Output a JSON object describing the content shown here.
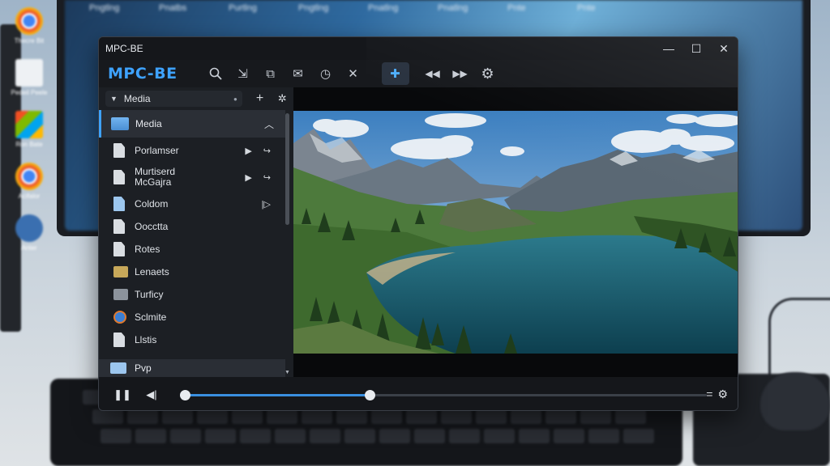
{
  "background": {
    "taskbar_labels": [
      "Pngtlng",
      "Pnatbs",
      "Purtlng",
      "Pngtlng",
      "Pnatlng",
      "Pnatlng",
      "Pnte",
      "Pnte"
    ],
    "desktop_icons": [
      {
        "label": "Thecre Bit",
        "icon": "chrome-icon"
      },
      {
        "label": "Pedeil Peele",
        "icon": "file-icon"
      },
      {
        "label": "Ron Bate",
        "icon": "app-grid-icon"
      },
      {
        "label": "Acifalor",
        "icon": "chrome-icon"
      },
      {
        "label": "Anter",
        "icon": "app-icon"
      }
    ]
  },
  "window": {
    "title": "MPC-BE",
    "controls": {
      "minimize": "—",
      "maximize": "☐",
      "close": "✕"
    }
  },
  "toolbar": {
    "brand": "MPC-BE",
    "buttons": [
      {
        "name": "search",
        "glyph": "⌕"
      },
      {
        "name": "user-add",
        "glyph": "⇲"
      },
      {
        "name": "file-stack",
        "glyph": "⧉"
      },
      {
        "name": "mail",
        "glyph": "✉"
      },
      {
        "name": "timer",
        "glyph": "◷"
      },
      {
        "name": "close",
        "glyph": "✕"
      }
    ],
    "active": {
      "name": "add-plugin",
      "glyph": "✚"
    },
    "after": [
      {
        "name": "rewind",
        "glyph": "◀◀"
      },
      {
        "name": "fast-forward",
        "glyph": "▶▶"
      },
      {
        "name": "settings",
        "glyph": "⚙"
      }
    ]
  },
  "sidebar": {
    "dropdown": "Media",
    "add_glyph": "+",
    "settings_glyph": "✲",
    "section": "Media",
    "items": [
      {
        "label": "Porlamser",
        "icon": "doc",
        "actions": [
          "▶",
          "↪"
        ]
      },
      {
        "label": "Murtiserd\nMcGajra",
        "icon": "doc",
        "actions": [
          "▶",
          "↪"
        ],
        "tall": true
      },
      {
        "label": "Coldom",
        "icon": "blue-doc",
        "actions": [
          "|▷"
        ]
      },
      {
        "label": "Oocctta",
        "icon": "doc",
        "actions": []
      },
      {
        "label": "Rotes",
        "icon": "doc",
        "actions": []
      },
      {
        "label": "Lenaets",
        "icon": "folder",
        "actions": []
      },
      {
        "label": "Turficy",
        "icon": "gray-box",
        "actions": []
      },
      {
        "label": "Sclmite",
        "icon": "round",
        "actions": []
      },
      {
        "label": "Llstis",
        "icon": "doc",
        "actions": []
      }
    ],
    "footer": "Pvp"
  },
  "player": {
    "progress": 0.36,
    "loaded": 0.36,
    "pause_glyph": "❚❚",
    "step_glyph": "◀|",
    "right_glyphs": [
      "=",
      "⚙"
    ]
  },
  "colors": {
    "accent": "#3ea2ff",
    "window_bg": "#17191d",
    "sidebar_bg": "#1c1f24",
    "seek_fill": "#3a8fe0"
  }
}
